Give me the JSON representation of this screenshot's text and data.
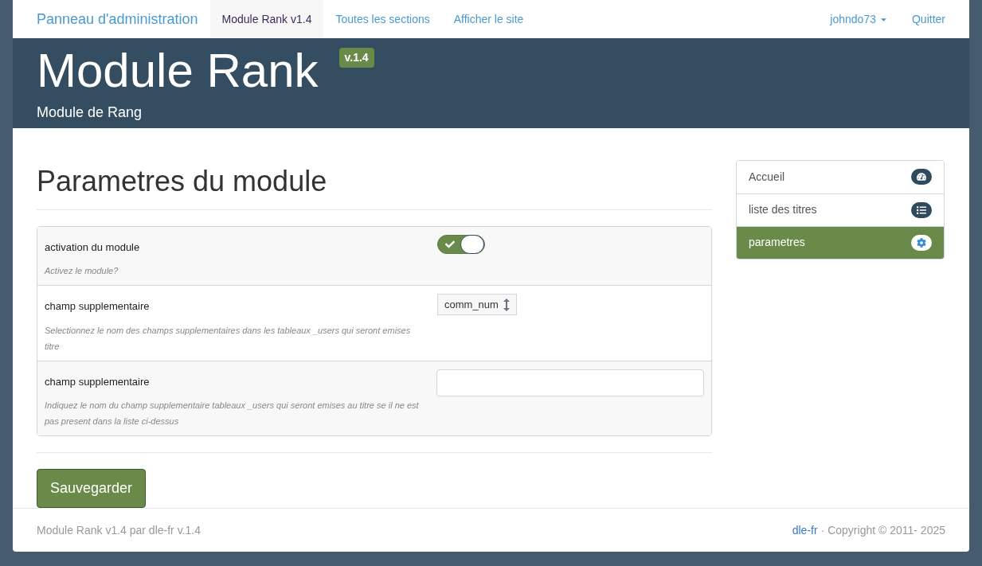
{
  "navbar": {
    "brand": "Panneau d'administration",
    "links": [
      {
        "label": "Module Rank v1.4",
        "selected": true
      },
      {
        "label": "Toutes les sections",
        "selected": false
      },
      {
        "label": "Afficher le site",
        "selected": false
      }
    ],
    "user": "johndo73",
    "logout": "Quitter"
  },
  "header": {
    "title": "Module Rank",
    "badge": "v.1.4",
    "subtitle": "Module de Rang"
  },
  "page_title": "Parametres du module",
  "settings": [
    {
      "kind": "toggle",
      "label": "activation du module",
      "hint": "Activez le module?",
      "on": true
    },
    {
      "kind": "select",
      "label": "champ supplementaire",
      "hint": "Selectionnez le nom des champs supplementaires dans les tableaux _users qui seront emises titre",
      "value": "comm_num"
    },
    {
      "kind": "text",
      "label": "champ supplementaire",
      "hint": "Indiquez le nom du champ supplementaire tableaux _users qui seront emises au titre se il ne est pas present dans la liste ci-dessus"
    }
  ],
  "save_button": "Sauvegarder",
  "sidebar": {
    "items": [
      {
        "label": "Accueil",
        "kind": "home",
        "selected": false
      },
      {
        "label": "liste des titres",
        "kind": "list",
        "selected": false
      },
      {
        "label": "parametres",
        "kind": "settings",
        "selected": true
      }
    ]
  },
  "footer": {
    "left": "Module Rank v1.4 par dle-fr v.1.4",
    "link": "dle-fr",
    "copyright": "· Copyright © 2011- 2025"
  }
}
